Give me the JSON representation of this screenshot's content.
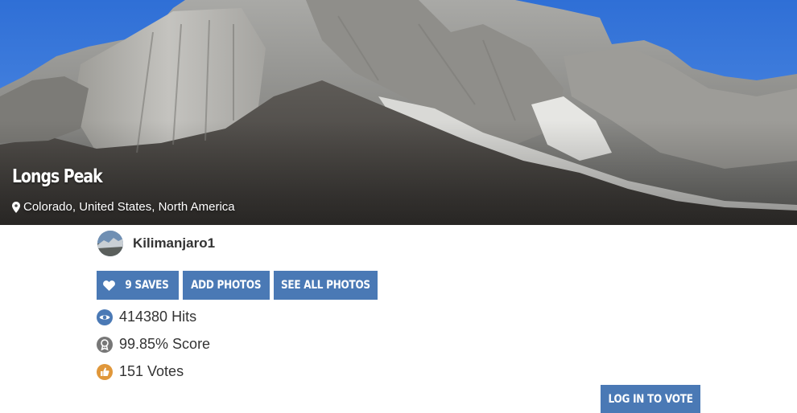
{
  "peak": {
    "name": "Longs Peak",
    "location": "Colorado, United States, North America"
  },
  "user": {
    "name": "Kilimanjaro1"
  },
  "actions": {
    "saves_label": "9 SAVES",
    "add_photos_label": "ADD PHOTOS",
    "see_all_photos_label": "SEE ALL PHOTOS"
  },
  "stats": {
    "hits": "414380 Hits",
    "score": "99.85% Score",
    "votes": "151 Votes"
  },
  "vote": {
    "label": "LOG IN TO VOTE"
  },
  "colors": {
    "button": "#4a79b5",
    "hits_icon": "#4a79b5",
    "score_icon": "#777777",
    "votes_icon": "#e0973a"
  },
  "icons": [
    "location-pin-icon",
    "heart-icon",
    "eye-icon",
    "medal-icon",
    "thumbs-up-icon"
  ]
}
